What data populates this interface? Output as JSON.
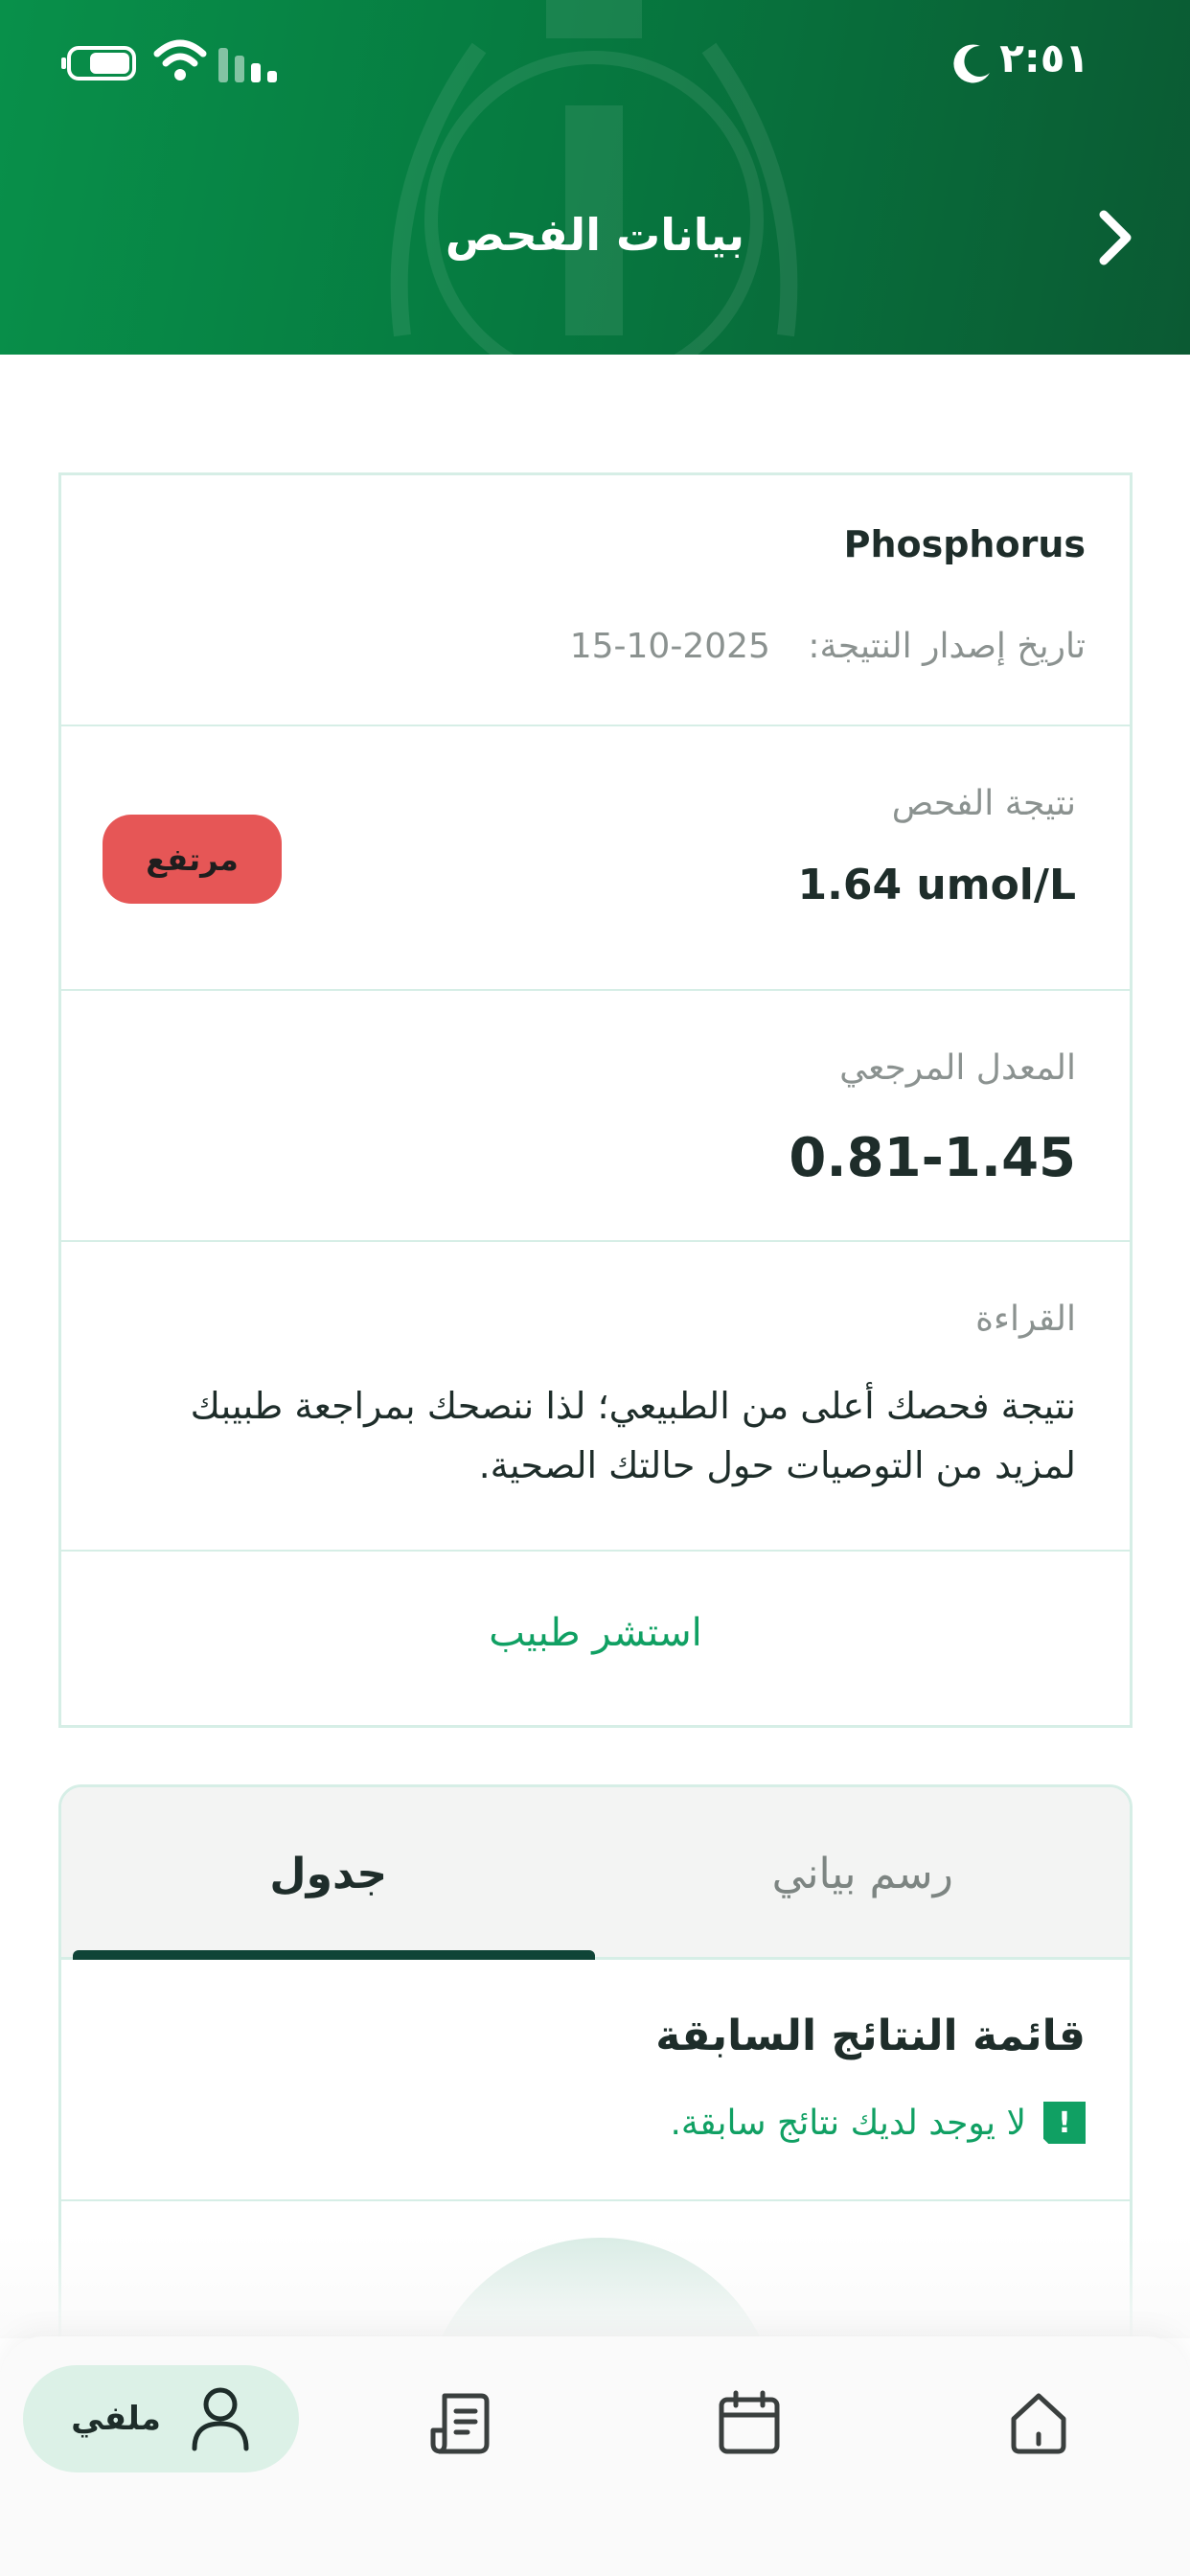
{
  "status_bar": {
    "time": "٢:٥١"
  },
  "header": {
    "title": "بيانات الفحص"
  },
  "result": {
    "test_name": "Phosphorus",
    "issue_date_label": "تاريخ إصدار النتيجة:",
    "issue_date": "2025-10-15",
    "result_label": "نتيجة الفحص",
    "result_value": "1.64 umol/L",
    "status_badge": "مرتفع",
    "reference_label": "المعدل المرجعي",
    "reference_value": "0.81-1.45",
    "reading_label": "القراءة",
    "reading_text": "نتيجة فحصك أعلى من الطبيعي؛ لذا ننصحك بمراجعة طبيبك لمزيد من التوصيات حول حالتك الصحية.",
    "consult_link": "استشر طبيب"
  },
  "history": {
    "tabs": [
      {
        "label": "رسم بياني",
        "active": false
      },
      {
        "label": "جدول",
        "active": true
      }
    ],
    "title": "قائمة النتائج السابقة",
    "empty_message": "لا يوجد لديك نتائج سابقة."
  },
  "bottom_nav": {
    "profile_label": "ملفي",
    "icons": [
      "profile-icon",
      "document-icon",
      "calendar-icon",
      "home-icon"
    ]
  },
  "colors": {
    "brand_green": "#08904a",
    "accent_green": "#10a063",
    "danger": "#e65656",
    "border": "#d6eee6",
    "tab_underline": "#0f4437"
  }
}
